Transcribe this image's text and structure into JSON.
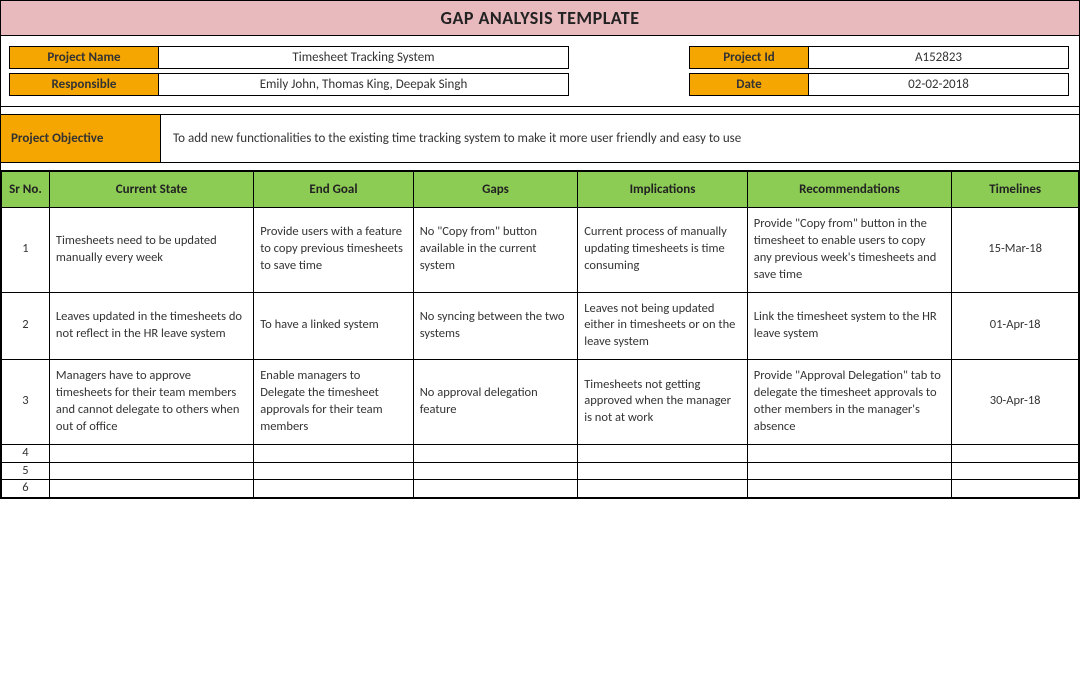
{
  "title": "GAP ANALYSIS TEMPLATE",
  "meta": {
    "project_name_label": "Project Name",
    "project_name": "Timesheet Tracking System",
    "project_id_label": "Project Id",
    "project_id": "A152823",
    "responsible_label": "Responsible",
    "responsible": "Emily John, Thomas King, Deepak Singh",
    "date_label": "Date",
    "date": "02-02-2018"
  },
  "objective": {
    "label": "Project Objective",
    "text": "To add new functionalities to the existing time tracking system to make it more user friendly and easy to use"
  },
  "headers": {
    "sr": "Sr No.",
    "current_state": "Current State",
    "end_goal": "End Goal",
    "gaps": "Gaps",
    "implications": "Implications",
    "recommendations": "Recommendations",
    "timelines": "Timelines"
  },
  "rows": [
    {
      "sr": "1",
      "current_state": "Timesheets need to be updated manually every week",
      "end_goal": "Provide users with a feature to copy previous timesheets to save time",
      "gaps": "No \"Copy from\" button available in the current system",
      "implications": "Current process of manually updating timesheets is time consuming",
      "recommendations": "Provide \"Copy from\" button in the timesheet to enable users to copy any previous week's timesheets and save time",
      "timelines": "15-Mar-18"
    },
    {
      "sr": "2",
      "current_state": "Leaves updated in the timesheets do not reflect in the HR leave system",
      "end_goal": "To have a linked system",
      "gaps": "No syncing between the two systems",
      "implications": "Leaves not being updated either in timesheets or on the leave system",
      "recommendations": "Link the timesheet system to the HR leave system",
      "timelines": "01-Apr-18"
    },
    {
      "sr": "3",
      "current_state": "Managers have to approve timesheets for their team members and cannot delegate to others when out of office",
      "end_goal": "Enable managers to Delegate the timesheet approvals for their team members",
      "gaps": "No approval delegation feature",
      "implications": "Timesheets not getting approved when the manager is not at work",
      "recommendations": "Provide \"Approval Delegation\" tab to delegate the timesheet approvals to other members in the manager's absence",
      "timelines": "30-Apr-18"
    },
    {
      "sr": "4",
      "current_state": "",
      "end_goal": "",
      "gaps": "",
      "implications": "",
      "recommendations": "",
      "timelines": ""
    },
    {
      "sr": "5",
      "current_state": "",
      "end_goal": "",
      "gaps": "",
      "implications": "",
      "recommendations": "",
      "timelines": ""
    },
    {
      "sr": "6",
      "current_state": "",
      "end_goal": "",
      "gaps": "",
      "implications": "",
      "recommendations": "",
      "timelines": ""
    }
  ]
}
